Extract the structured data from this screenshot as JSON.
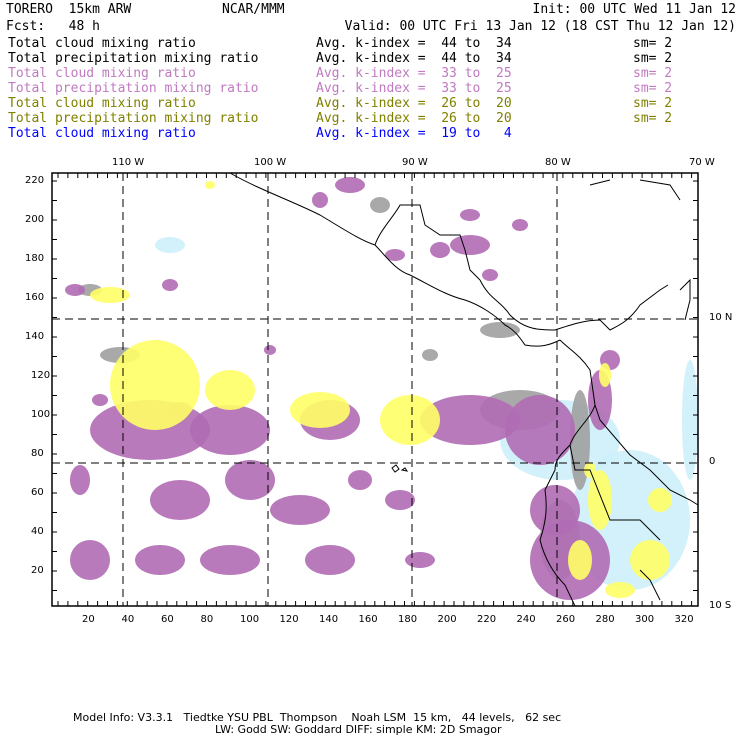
{
  "header": {
    "model": "TORERO  15km ARW",
    "org": "NCAR/MMM",
    "init": "Init: 00 UTC Wed 11 Jan 12",
    "fcst": "Fcst:   48 h",
    "valid": "Valid: 00 UTC Fri 13 Jan 12 (18 CST Thu 12 Jan 12)"
  },
  "legend": [
    {
      "field": "Total cloud mixing ratio",
      "range": "Avg. k-index =  44 to  34",
      "sm": "sm= 2",
      "color": "#000000"
    },
    {
      "field": "Total precipitation mixing ratio",
      "range": "Avg. k-index =  44 to  34",
      "sm": "sm= 2",
      "color": "#000000"
    },
    {
      "field": "Total cloud mixing ratio",
      "range": "Avg. k-index =  33 to  25",
      "sm": "sm= 2",
      "color": "#c07ac0"
    },
    {
      "field": "Total precipitation mixing ratio",
      "range": "Avg. k-index =  33 to  25",
      "sm": "sm= 2",
      "color": "#c07ac0"
    },
    {
      "field": "Total cloud mixing ratio",
      "range": "Avg. k-index =  26 to  20",
      "sm": "sm= 2",
      "color": "#808000"
    },
    {
      "field": "Total precipitation mixing ratio",
      "range": "Avg. k-index =  26 to  20",
      "sm": "sm= 2",
      "color": "#808000"
    },
    {
      "field": "Total cloud mixing ratio",
      "range": "Avg. k-index =  19 to   4",
      "sm": "",
      "color": "#0000ff"
    }
  ],
  "map": {
    "lon_labels": [
      "110 W",
      "100 W",
      "90 W",
      "80 W",
      "70 W"
    ],
    "lat_labels": [
      "10 N",
      "0",
      "10 S"
    ],
    "x_ticks": [
      "20",
      "40",
      "60",
      "80",
      "100",
      "120",
      "140",
      "160",
      "180",
      "200",
      "220",
      "240",
      "260",
      "280",
      "300",
      "320"
    ],
    "y_ticks": [
      "220",
      "200",
      "180",
      "160",
      "140",
      "120",
      "100",
      "80",
      "60",
      "40",
      "20"
    ],
    "colors": {
      "gray": "#a0a0a0",
      "purple": "#b06cb4",
      "yellow": "#ffff66",
      "lightblue": "#cdeffa"
    }
  },
  "footer": {
    "line1": "Model Info: V3.3.1   Tiedtke YSU PBL  Thompson    Noah LSM  15 km,   44 levels,   62 sec",
    "line2": "LW: Godd SW: Goddard DIFF: simple KM: 2D Smagor"
  }
}
